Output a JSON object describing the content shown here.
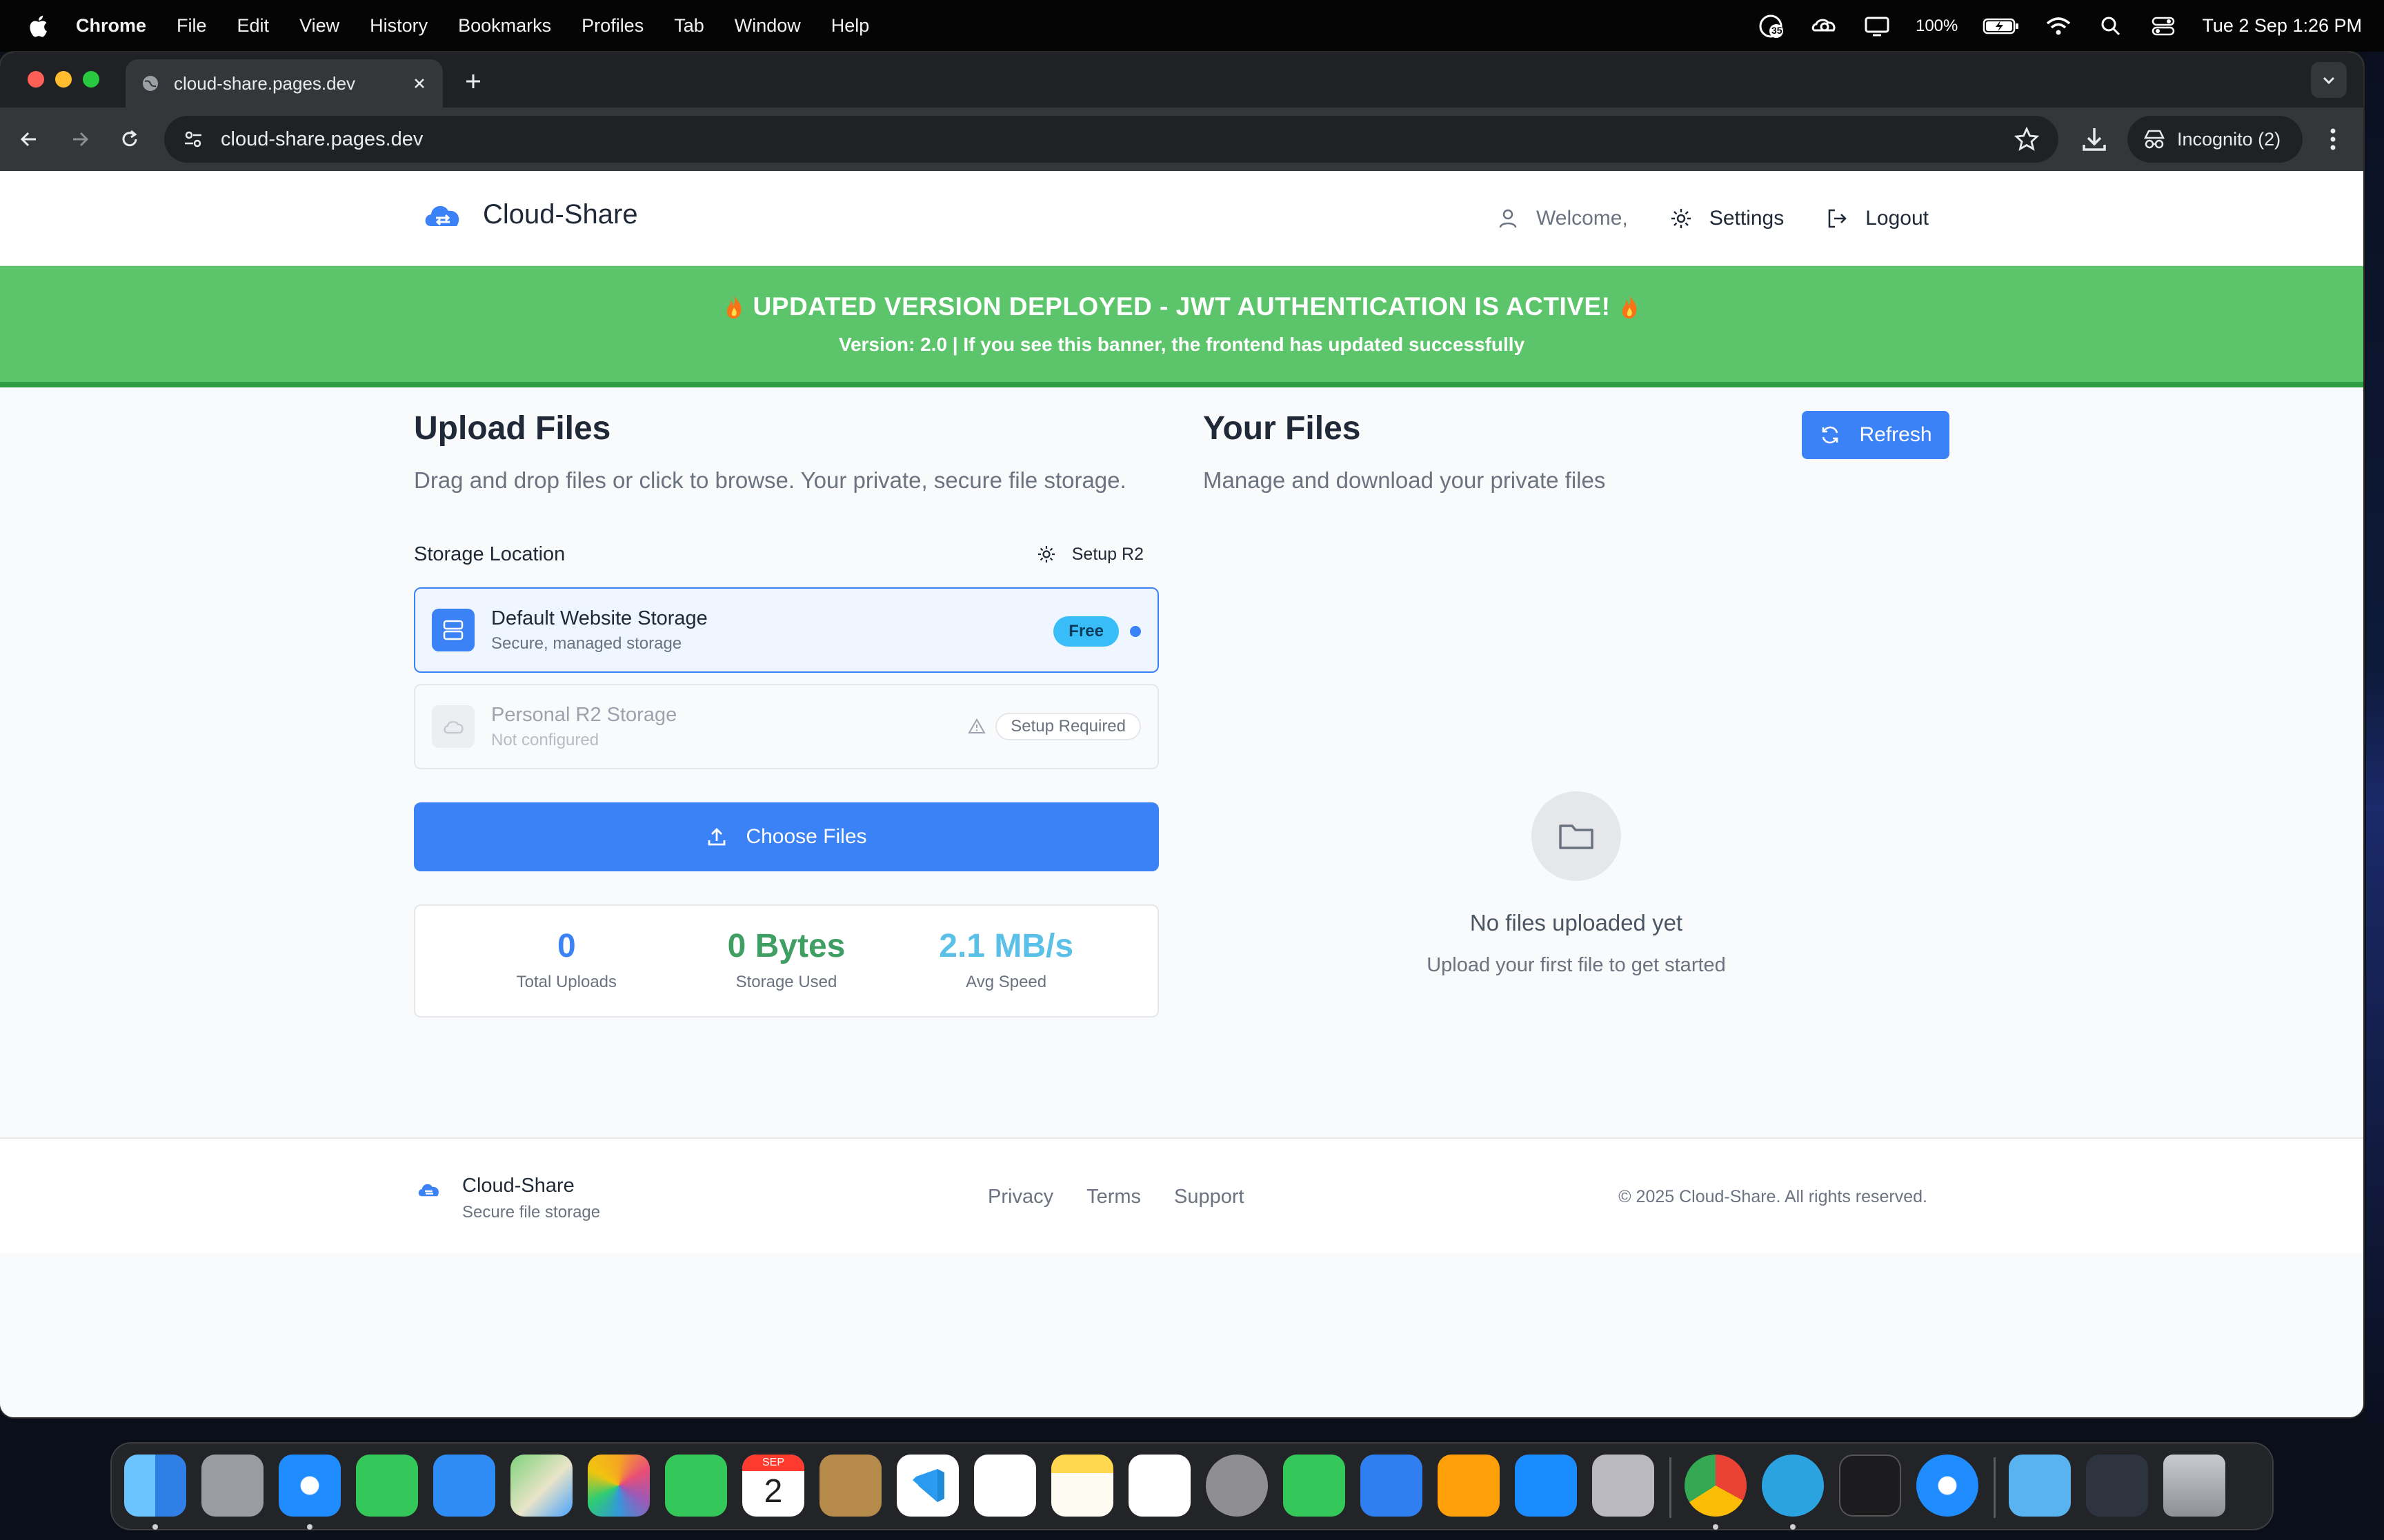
{
  "menubar": {
    "app_name": "Chrome",
    "items": [
      "File",
      "Edit",
      "View",
      "History",
      "Bookmarks",
      "Profiles",
      "Tab",
      "Window",
      "Help"
    ],
    "battery": "100%",
    "datetime": "Tue 2 Sep  1:26 PM",
    "badge_count": "35"
  },
  "browser": {
    "tab_title": "cloud-share.pages.dev",
    "url": "cloud-share.pages.dev",
    "incognito_label": "Incognito (2)"
  },
  "site": {
    "brand": "Cloud-Share",
    "nav": {
      "welcome": "Welcome,",
      "settings": "Settings",
      "logout": "Logout"
    },
    "banner": {
      "title": "UPDATED VERSION DEPLOYED - JWT AUTHENTICATION IS ACTIVE!",
      "subtitle": "Version: 2.0 | If you see this banner, the frontend has updated successfully"
    },
    "upload": {
      "title": "Upload Files",
      "subtitle": "Drag and drop files or click to browse. Your private, secure file storage.",
      "storage_label": "Storage Location",
      "setup_r2": "Setup R2",
      "default_storage": {
        "title": "Default Website Storage",
        "subtitle": "Secure, managed storage",
        "badge": "Free"
      },
      "personal_storage": {
        "title": "Personal R2 Storage",
        "subtitle": "Not configured",
        "badge": "Setup Required"
      },
      "choose_files": "Choose Files",
      "stats": [
        {
          "value": "0",
          "label": "Total Uploads",
          "color": "#3b82f6"
        },
        {
          "value": "0 Bytes",
          "label": "Storage Used",
          "color": "#3f9e62"
        },
        {
          "value": "2.1 MB/s",
          "label": "Avg Speed",
          "color": "#5bc0e8"
        }
      ]
    },
    "files": {
      "title": "Your Files",
      "subtitle": "Manage and download your private files",
      "refresh": "Refresh",
      "empty_title": "No files uploaded yet",
      "empty_subtitle": "Upload your first file to get started"
    },
    "footer": {
      "brand": "Cloud-Share",
      "tagline": "Secure file storage",
      "links": [
        "Privacy",
        "Terms",
        "Support"
      ],
      "copyright": "© 2025 Cloud-Share. All rights reserved."
    }
  },
  "colors": {
    "accent": "#3b82f6",
    "banner_green": "#5cc46a",
    "banner_border": "#2f9b45"
  },
  "dock": {
    "apps": [
      "finder",
      "launchpad",
      "safari",
      "messages",
      "mail",
      "maps",
      "photos",
      "facetime",
      "calendar",
      "contacts",
      "vscode",
      "reminders",
      "notes",
      "freeform",
      "system-settings",
      "numbers",
      "keynote",
      "pages",
      "app-store",
      "iphone-mirroring",
      "chrome",
      "telegram",
      "terminal",
      "safari-2",
      "downloads-folder",
      "screenshot-stack",
      "trash"
    ],
    "calendar_month": "SEP",
    "calendar_day": "2"
  }
}
